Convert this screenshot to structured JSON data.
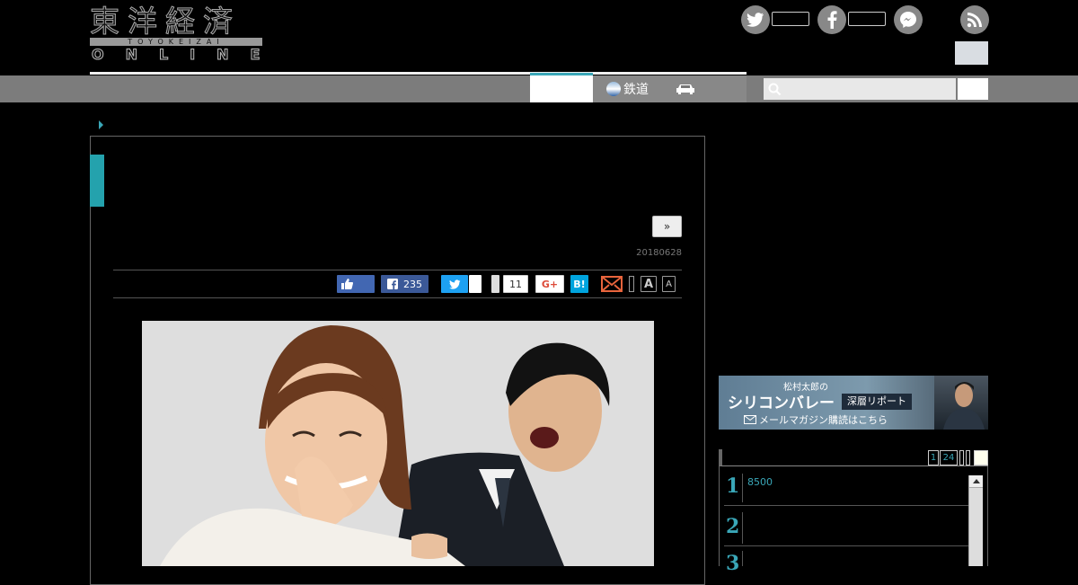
{
  "header": {
    "logo_kanji": "東洋経済",
    "logo_romaji": "TOYOKEIZAI",
    "logo_online": "ONLINE"
  },
  "social": {
    "twitter_icon": "twitter-icon",
    "facebook_icon": "facebook-icon",
    "messenger_icon": "messenger-icon",
    "rss_icon": "rss-icon"
  },
  "nav": {
    "items": [
      {
        "label": "鉄道",
        "icon": "train-icon"
      },
      {
        "label": "",
        "icon": "car-icon"
      }
    ],
    "search_placeholder": ""
  },
  "article": {
    "next_label": "»",
    "date": "20180628",
    "share": {
      "like_count": "",
      "facebook_count": "235",
      "twitter_count": "",
      "pocket_count": "11",
      "gplus_label": "G+",
      "hatena_label": "B!",
      "font_large": "A",
      "font_small": "A"
    }
  },
  "sidebar": {
    "banner": {
      "line1": "松村太郎の",
      "line2": "シリコンバレー",
      "line3": "深層リポート",
      "line4": "メールマガジン購読はこちら"
    },
    "ranking": {
      "tabs": [
        "1",
        "24"
      ],
      "items": [
        {
          "rank": "1",
          "text": "8500"
        },
        {
          "rank": "2",
          "text": ""
        },
        {
          "rank": "3",
          "text": ""
        }
      ]
    }
  },
  "colors": {
    "accent": "#24a2ad",
    "nav": "#7c7c7c",
    "background": "#000000"
  }
}
